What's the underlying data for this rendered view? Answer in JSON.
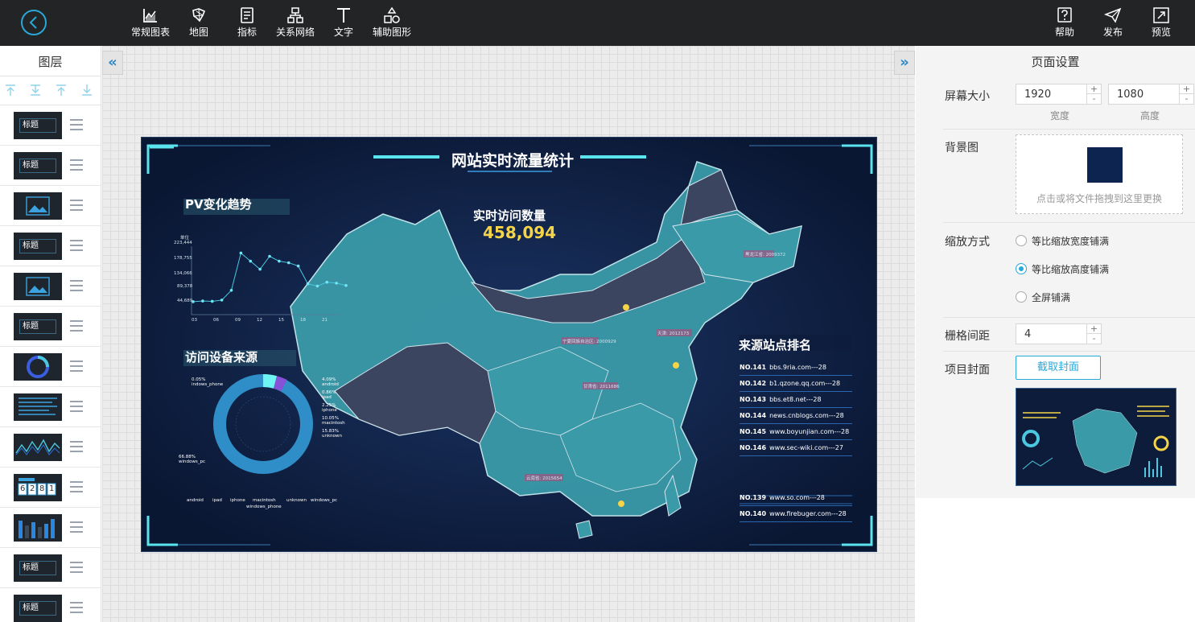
{
  "toolbar": {
    "tools": [
      {
        "label": "常规图表",
        "icon": "chart-icon"
      },
      {
        "label": "地图",
        "icon": "map-icon"
      },
      {
        "label": "指标",
        "icon": "indicator-icon"
      },
      {
        "label": "关系网络",
        "icon": "network-icon"
      },
      {
        "label": "文字",
        "icon": "text-icon"
      },
      {
        "label": "辅助图形",
        "icon": "shapes-icon"
      }
    ],
    "right_tools": [
      {
        "label": "帮助",
        "icon": "help-icon"
      },
      {
        "label": "发布",
        "icon": "publish-icon"
      },
      {
        "label": "预览",
        "icon": "preview-icon"
      }
    ]
  },
  "layers_panel": {
    "title": "图层",
    "thumb_title_text": "标题",
    "layers": [
      {
        "type": "title"
      },
      {
        "type": "title"
      },
      {
        "type": "image"
      },
      {
        "type": "title"
      },
      {
        "type": "image"
      },
      {
        "type": "title"
      },
      {
        "type": "ring"
      },
      {
        "type": "list"
      },
      {
        "type": "line"
      },
      {
        "type": "counter",
        "digits": "6281"
      },
      {
        "type": "bar"
      },
      {
        "type": "title"
      },
      {
        "type": "title"
      }
    ]
  },
  "dashboard": {
    "title": "网站实时流量统计",
    "pv_title": "PV变化趋势",
    "realtime_title": "实时访问数量",
    "realtime_value": "458,094",
    "device_title": "访问设备来源",
    "rank_title": "来源站点排名",
    "pv_chart": {
      "unit": "单位",
      "y_ticks": [
        "223,444",
        "178,755",
        "134,066",
        "89,378",
        "44,689"
      ],
      "x_ticks": [
        "03",
        "06",
        "09",
        "12",
        "15",
        "18",
        "21"
      ]
    },
    "device_labels": [
      {
        "pct": "0.05%",
        "name": "indows_phone"
      },
      {
        "pct": "4.09%",
        "name": "android"
      },
      {
        "pct": "0.86%",
        "name": "ipad"
      },
      {
        "pct": "2.25%",
        "name": "iphone"
      },
      {
        "pct": "10.05%",
        "name": "macintosh"
      },
      {
        "pct": "15.83%",
        "name": "unknown"
      },
      {
        "pct": "66.88%",
        "name": "windows_pc"
      }
    ],
    "device_legend": [
      "android",
      "ipad",
      "iphone",
      "macintosh",
      "unknown",
      "windows_pc",
      "windows_phone"
    ],
    "rank_rows": [
      {
        "no": "NO.141",
        "site": "bbs.9ria.com---28"
      },
      {
        "no": "NO.142",
        "site": "b1.qzone.qq.com---28"
      },
      {
        "no": "NO.143",
        "site": "bbs.et8.net---28"
      },
      {
        "no": "NO.144",
        "site": "news.cnblogs.com---28"
      },
      {
        "no": "NO.145",
        "site": "www.boyunjian.com---28"
      },
      {
        "no": "NO.146",
        "site": "www.sec-wiki.com---27"
      },
      {
        "no": "",
        "site": ""
      },
      {
        "no": "",
        "site": ""
      },
      {
        "no": "",
        "site": ""
      },
      {
        "no": "NO.139",
        "site": "www.so.com---28"
      },
      {
        "no": "NO.140",
        "site": "www.firebuger.com---28"
      }
    ],
    "map_labels": [
      "黑龙江省: 2009372",
      "宁夏回族自治区: 2000929",
      "天津: 2012173",
      "甘肃省: 2011686",
      "云南省: 2015654"
    ]
  },
  "settings": {
    "title": "页面设置",
    "screen_size_label": "屏幕大小",
    "width_value": "1920",
    "height_value": "1080",
    "width_label": "宽度",
    "height_label": "高度",
    "bg_label": "背景图",
    "bg_color": "#0d2350",
    "bg_hint": "点击或将文件拖拽到这里更换",
    "scale_label": "缩放方式",
    "scale_options": [
      {
        "label": "等比缩放宽度铺满",
        "checked": false
      },
      {
        "label": "等比缩放高度铺满",
        "checked": true
      },
      {
        "label": "全屏铺满",
        "checked": false
      }
    ],
    "grid_label": "栅格间距",
    "grid_value": "4",
    "cover_label": "项目封面",
    "cover_button": "截取封面"
  },
  "colors": {
    "accent": "#29a8d8",
    "topbar": "#222426",
    "dash_bg": "#0d1c3b",
    "map_fill": "#3a9aa8",
    "highlight_value": "#f5d547"
  }
}
